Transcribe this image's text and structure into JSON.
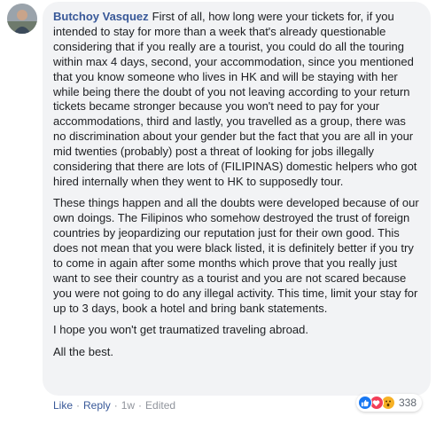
{
  "comment": {
    "author": "Butchoy Vasquez",
    "paragraphs": [
      "First of all, how long were your tickets for, if you intended to stay for more than a week that's already questionable considering that if you really are a tourist, you could do all the touring within max 4 days, second, your accommodation, since you mentioned that you know someone who lives in HK and will be staying with her while being there the doubt of you not leaving according to your return tickets became stronger because you won't need to pay for your accommodations, third and lastly, you travelled as a group, there was no discrimination about your gender but the fact that you are all in your mid twenties (probably) post a threat of looking for jobs illegally considering that there are lots of (FILIPINAS) domestic helpers who got hired internally when they went to HK to supposedly tour.",
      "These things happen and all the doubts were developed because of our own doings. The Filipinos who somehow destroyed the trust of foreign countries by jeopardizing our reputation just for their own good. This does not mean that you were black listed, it is definitely better if you try to come in again after some months which prove that you really just want to see their country as a tourist and you are not scared because you were not going to do any illegal activity. This time, limit your stay for up to 3 days, book a hotel and bring bank statements.",
      "I hope you won't get traumatized traveling abroad.",
      "All the best."
    ],
    "reactions": {
      "icons": [
        "like-icon",
        "love-icon",
        "wow-icon"
      ],
      "count": "338"
    },
    "actions": {
      "like": "Like",
      "reply": "Reply",
      "time": "1w",
      "edited": "Edited",
      "separator": "·"
    }
  },
  "colors": {
    "author": "#385898",
    "bubble": "#f2f3f5",
    "like": "#1877f2",
    "love": "#f33e58",
    "wow": "#f7b125"
  }
}
